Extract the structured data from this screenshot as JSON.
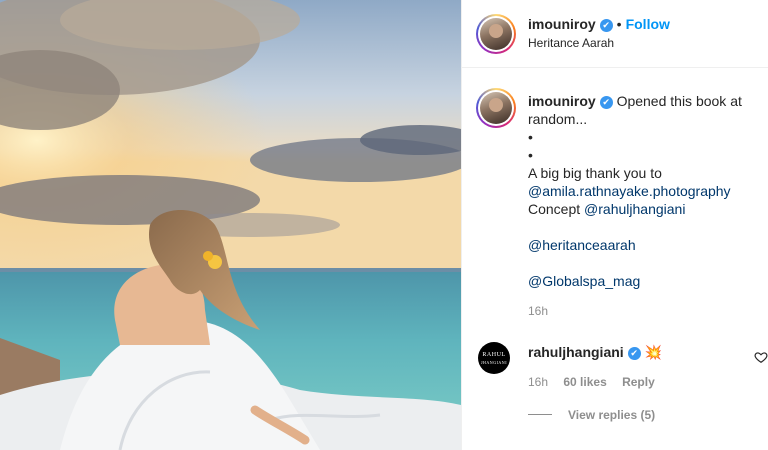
{
  "post": {
    "username": "imouniroy",
    "verified_mark": "✔",
    "separator": "•",
    "follow_label": "Follow",
    "location": "Heritance Aarah"
  },
  "caption": {
    "username": "imouniroy",
    "text_first": "Opened this book at random...",
    "bullet1": "•",
    "bullet2": "•",
    "thanks": "A big big thank you to",
    "mention_photo": "@amila.rathnayake.photography",
    "concept_label": "Concept",
    "mention_concept": "@rahuljhangiani",
    "mention_resort": "@heritanceaarah",
    "mention_spa": "@Globalspa_mag",
    "time": "16h"
  },
  "comment": {
    "username": "rahuljhangiani",
    "avatar_text_1": "RAHUL",
    "avatar_text_2": "JHANGIANI",
    "emoji": "💥",
    "time": "16h",
    "likes": "60 likes",
    "reply_label": "Reply",
    "view_replies": "View replies (5)"
  },
  "icons": {
    "verified": "verified-badge-icon",
    "heart": "heart-outline-icon"
  },
  "colors": {
    "link": "#00376b",
    "follow": "#0095f6",
    "verified": "#3897f0"
  }
}
